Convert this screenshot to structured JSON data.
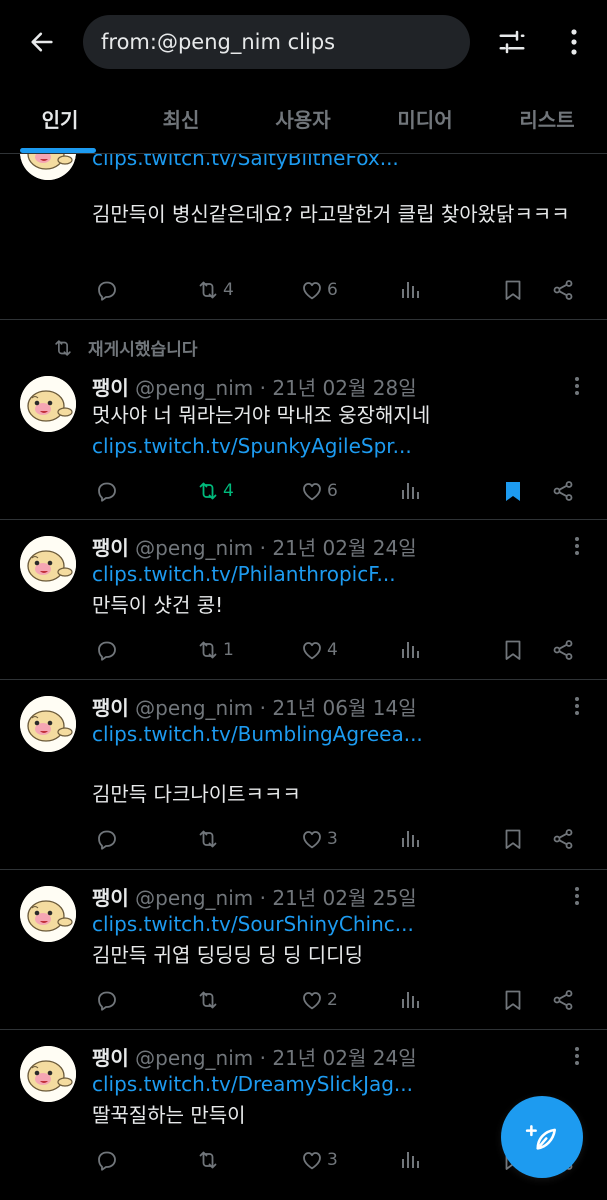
{
  "search": {
    "query": "from:@peng_nim clips"
  },
  "tabs": [
    {
      "label": "인기"
    },
    {
      "label": "최신"
    },
    {
      "label": "사용자"
    },
    {
      "label": "미디어"
    },
    {
      "label": "리스트"
    }
  ],
  "colors": {
    "accent": "#1d9bf0",
    "repost_active": "#00ba7c",
    "muted": "#71767b",
    "background": "#000000"
  },
  "tweets": [
    {
      "link": "clips.twitch.tv/SaltyBlitheFox...",
      "text": "김만득이 병신같은데요? 라고말한거 클립 찾아왔닭ㅋㅋㅋ",
      "reposts": "4",
      "likes": "6",
      "bookmarked": false
    },
    {
      "repost_label": "재게시했습니다",
      "name": "팽이",
      "handle": "@peng_nim",
      "date": "21년 02월 28일",
      "text": "멋사야 너 뭐라는거야 막내조 웅장해지네",
      "link": "clips.twitch.tv/SpunkyAgileSpr...",
      "reposts": "4",
      "likes": "6",
      "bookmarked": true,
      "reposted": true
    },
    {
      "name": "팽이",
      "handle": "@peng_nim",
      "date": "21년 02월 24일",
      "link": "clips.twitch.tv/PhilanthropicF...",
      "text": "만득이 샷건 콩!",
      "reposts": "1",
      "likes": "4",
      "bookmarked": false
    },
    {
      "name": "팽이",
      "handle": "@peng_nim",
      "date": "21년 06월 14일",
      "link": "clips.twitch.tv/BumblingAgreea...",
      "text": "김만득 다크나이트ㅋㅋㅋ",
      "reposts": "",
      "likes": "3",
      "bookmarked": false
    },
    {
      "name": "팽이",
      "handle": "@peng_nim",
      "date": "21년 02월 25일",
      "link": "clips.twitch.tv/SourShinyChinc...",
      "text": "김만득 귀엽 딩딩딩 딩 딩 디디딩",
      "reposts": "",
      "likes": "2",
      "bookmarked": false
    },
    {
      "name": "팽이",
      "handle": "@peng_nim",
      "date": "21년 02월 24일",
      "link": "clips.twitch.tv/DreamySlickJag...",
      "text": "딸꾹질하는 만득이",
      "reposts": "",
      "likes": "3",
      "bookmarked": false
    }
  ],
  "icons": [
    "back-arrow-icon",
    "filter-icon",
    "more-vertical-icon",
    "reply-icon",
    "repost-icon",
    "like-icon",
    "views-icon",
    "bookmark-icon",
    "share-icon",
    "compose-icon"
  ]
}
